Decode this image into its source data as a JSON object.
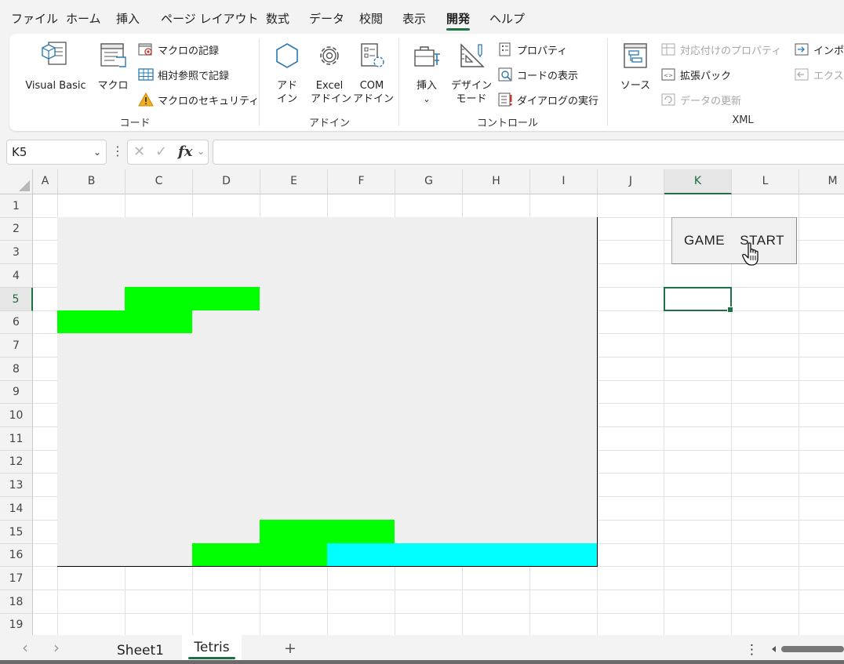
{
  "ribbon_tabs": [
    "ファイル",
    "ホーム",
    "挿入",
    "ページ レイアウト",
    "数式",
    "データ",
    "校閲",
    "表示",
    "開発",
    "ヘルプ"
  ],
  "active_tab": "開発",
  "ribbon": {
    "code": {
      "visual_basic": "Visual Basic",
      "macro": "マクロ",
      "record_macro": "マクロの記録",
      "relative_ref": "相対参照で記録",
      "macro_security": "マクロのセキュリティ",
      "group": "コード"
    },
    "addins": {
      "addin_1": "アド",
      "addin_2": "イン",
      "excel_1": "Excel",
      "excel_2": "アドイン",
      "com_1": "COM",
      "com_2": "アドイン",
      "group": "アドイン"
    },
    "controls": {
      "insert": "挿入",
      "insert_arrow": "⌄",
      "design_1": "デザイン",
      "design_2": "モード",
      "properties": "プロパティ",
      "view_code": "コードの表示",
      "run_dialog": "ダイアログの実行",
      "group": "コントロール"
    },
    "xml": {
      "source": "ソース",
      "map_properties": "対応付けのプロパティ",
      "expansion_packs": "拡張パック",
      "refresh_data": "データの更新",
      "import": "インポ",
      "export": "エクスポ",
      "group": "XML"
    }
  },
  "formula_bar": {
    "name_box": "K5",
    "name_box_arrow": "⌄",
    "menu_dots": "⋮",
    "cancel": "✕",
    "enter": "✓",
    "fx": "fx",
    "fx_arrow": "⌄",
    "formula": ""
  },
  "grid": {
    "columns": [
      "A",
      "B",
      "C",
      "D",
      "E",
      "F",
      "G",
      "H",
      "I",
      "J",
      "K",
      "L",
      "M"
    ],
    "rows": [
      "1",
      "2",
      "3",
      "4",
      "5",
      "6",
      "7",
      "8",
      "9",
      "10",
      "11",
      "12",
      "13",
      "14",
      "15",
      "16",
      "17",
      "18",
      "19"
    ],
    "selected_cell": "K5",
    "board": {
      "first_column": "B",
      "last_column": "I",
      "first_row": 2,
      "last_row": 16,
      "empty_color": "#efefef",
      "filled": [
        {
          "cell": "C5",
          "color": "#00ff00"
        },
        {
          "cell": "D5",
          "color": "#00ff00"
        },
        {
          "cell": "B6",
          "color": "#00ff00"
        },
        {
          "cell": "C6",
          "color": "#00ff00"
        },
        {
          "cell": "E15",
          "color": "#00ff00"
        },
        {
          "cell": "F15",
          "color": "#00ff00"
        },
        {
          "cell": "D16",
          "color": "#00ff00"
        },
        {
          "cell": "E16",
          "color": "#00ff00"
        },
        {
          "cell": "F16",
          "color": "#00ffff"
        },
        {
          "cell": "G16",
          "color": "#00ffff"
        },
        {
          "cell": "H16",
          "color": "#00ffff"
        },
        {
          "cell": "I16",
          "color": "#00ffff"
        }
      ]
    },
    "start_button": "GAME  START"
  },
  "sheet_tabs": {
    "prev": "‹",
    "next": "›",
    "tabs": [
      "Sheet1",
      "Tetris"
    ],
    "active": "Tetris",
    "add": "+",
    "options": "⋮"
  },
  "colors": {
    "accent": "#1e7145",
    "tetromino_green": "#00ff00",
    "tetromino_cyan": "#00ffff"
  }
}
